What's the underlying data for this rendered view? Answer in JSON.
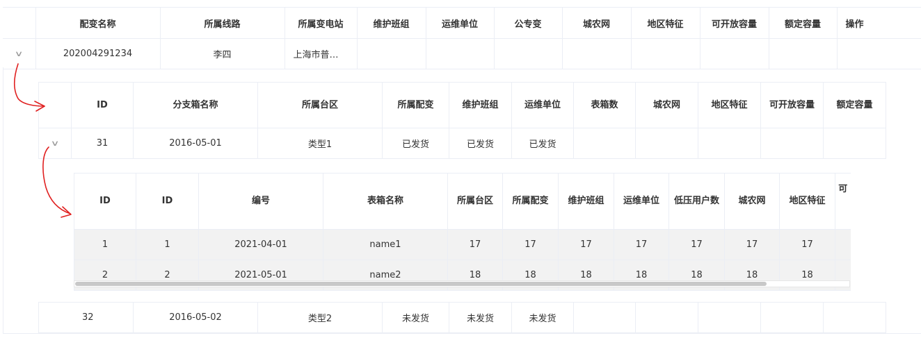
{
  "main_table": {
    "headers": [
      "配变名称",
      "所属线路",
      "所属变电站",
      "维护班组",
      "运维单位",
      "公专变",
      "城农网",
      "地区特征",
      "可开放容量",
      "额定容量",
      "操作"
    ],
    "row": {
      "name": "202004291234",
      "line": "李四",
      "substation": "上海市普…"
    }
  },
  "branch_table": {
    "headers": [
      "ID",
      "分支箱名称",
      "所属台区",
      "所属配变",
      "维护班组",
      "运维单位",
      "表箱数",
      "城农网",
      "地区特征",
      "可开放容量",
      "额定容量"
    ],
    "rows": [
      {
        "id": "31",
        "name": "2016-05-01",
        "area": "类型1",
        "transformer": "已发货",
        "team": "已发货",
        "unit": "已发货"
      },
      {
        "id": "32",
        "name": "2016-05-02",
        "area": "类型2",
        "transformer": "未发货",
        "team": "未发货",
        "unit": "未发货"
      }
    ]
  },
  "meter_table": {
    "headers": [
      "ID",
      "ID",
      "编号",
      "表箱名称",
      "所属台区",
      "所属配变",
      "维护班组",
      "运维单位",
      "低压用户数",
      "城农网",
      "地区特征",
      "可"
    ],
    "rows": [
      {
        "a": "1",
        "b": "1",
        "code": "2021-04-01",
        "name": "name1",
        "v1": "17",
        "v2": "17",
        "v3": "17",
        "v4": "17",
        "v5": "17",
        "v6": "17",
        "v7": "17"
      },
      {
        "a": "2",
        "b": "2",
        "code": "2021-05-01",
        "name": "name2",
        "v1": "18",
        "v2": "18",
        "v3": "18",
        "v4": "18",
        "v5": "18",
        "v6": "18",
        "v7": "18"
      }
    ]
  },
  "icons": {
    "expand": "chevron-down-icon"
  },
  "colors": {
    "annotation_arrow": "#e02020",
    "border": "#ebeef5",
    "scrollbar": "#c8c8c8"
  }
}
